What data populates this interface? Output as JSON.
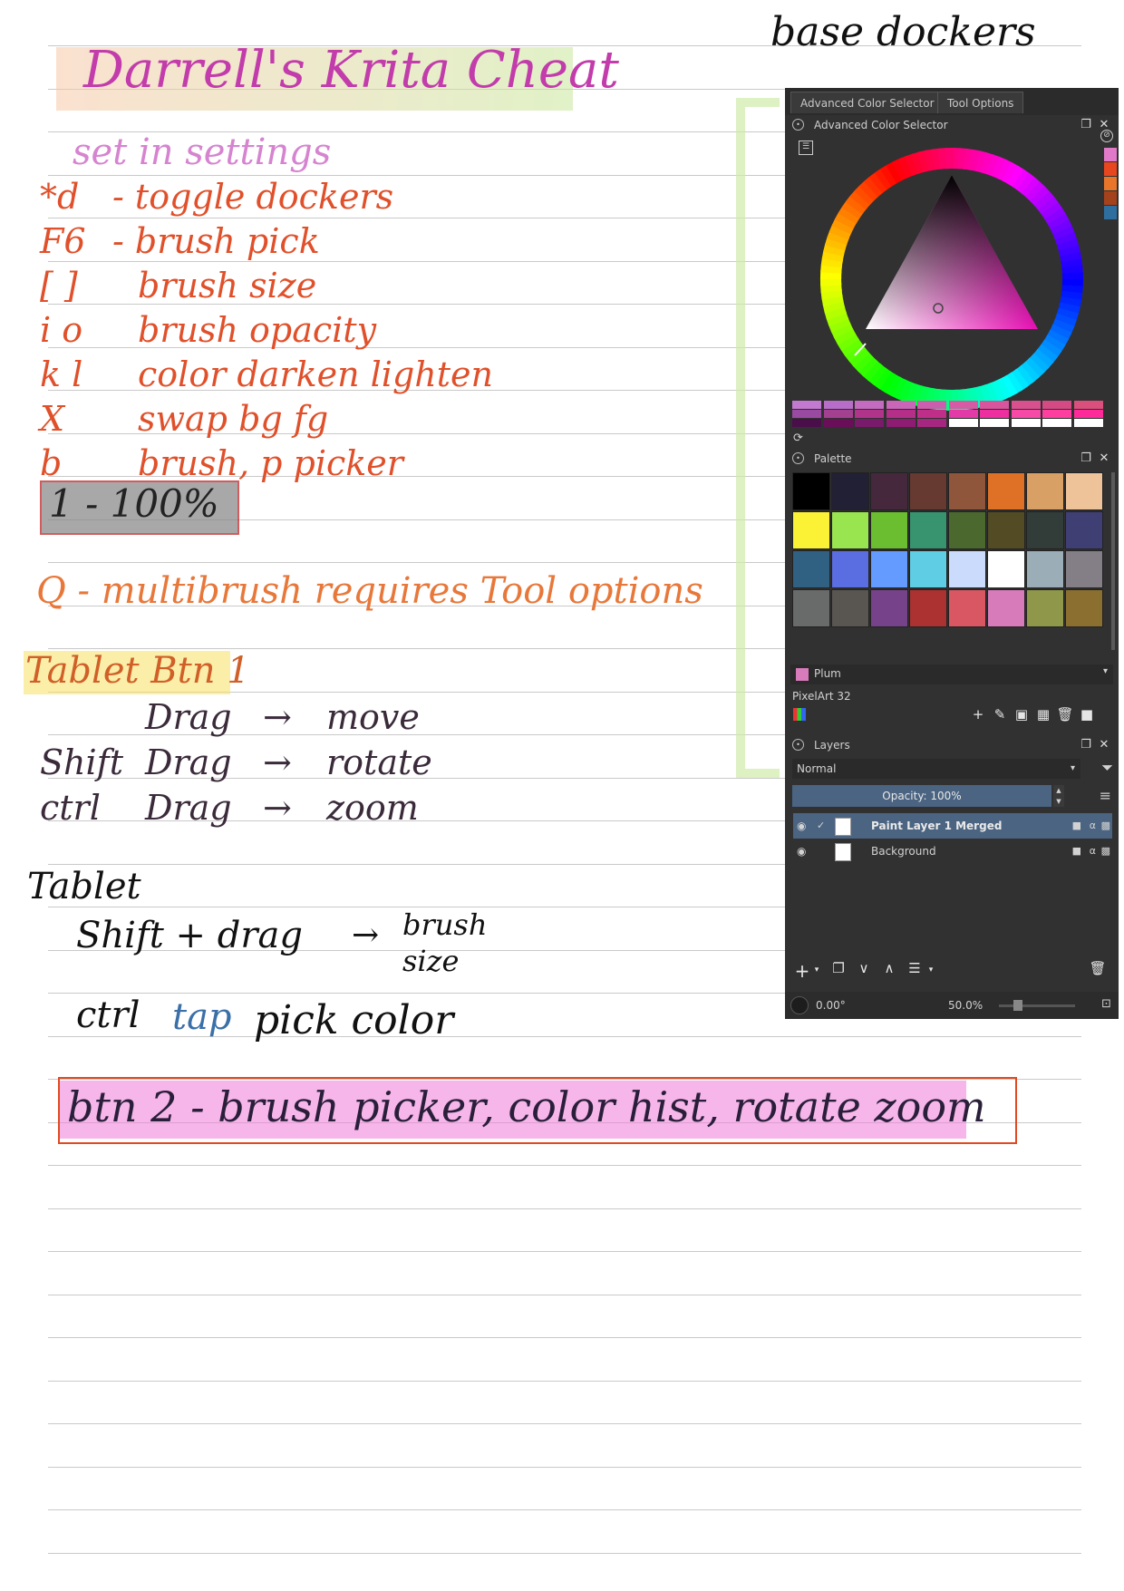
{
  "notes": {
    "title": "Darrell's Krita Cheat",
    "header_right": "base dockers",
    "settings_heading": "set in settings",
    "shortcuts": [
      {
        "key": "*d",
        "desc": "- toggle dockers"
      },
      {
        "key": "F6",
        "desc": "- brush pick"
      },
      {
        "key": "[ ]",
        "desc": "brush size"
      },
      {
        "key": "i o",
        "desc": "brush opacity"
      },
      {
        "key": "k l",
        "desc": "color darken lighten"
      },
      {
        "key": "X",
        "desc": "swap bg fg"
      },
      {
        "key": "b",
        "desc": "brush, p picker"
      }
    ],
    "one_hundred": "1 - 100%",
    "multibrush": "Q - multibrush requires Tool options",
    "tablet_btn1": {
      "heading": "Tablet Btn 1",
      "rows": [
        {
          "mod": "",
          "action": "Drag",
          "arrow": "→",
          "result": "move"
        },
        {
          "mod": "Shift",
          "action": "Drag",
          "arrow": "→",
          "result": "rotate"
        },
        {
          "mod": "ctrl",
          "action": "Drag",
          "arrow": "→",
          "result": "zoom"
        }
      ]
    },
    "tablet": {
      "heading": "Tablet",
      "shift_drag": "Shift + drag",
      "arrow": "→",
      "brush_size": "brush",
      "brush_size2": "size",
      "ctrl": "ctrl",
      "tap": "tap",
      "pick_color": "pick color"
    },
    "btn2": "btn 2 - brush picker, color hist, rotate zoom"
  },
  "krita": {
    "tabs": [
      "Advanced Color Selector",
      "Tool Options"
    ],
    "color_selector_title": "Advanced Color Selector",
    "palette_title": "Palette",
    "palette_selected": "Plum",
    "palette_name": "PixelArt 32",
    "layers_title": "Layers",
    "blend_mode": "Normal",
    "opacity": "Opacity:  100%",
    "layers": [
      {
        "name": "Paint Layer 1 Merged",
        "selected": true
      },
      {
        "name": "Background",
        "selected": false
      }
    ],
    "rotation": "0.00°",
    "zoom": "50.0%",
    "history_colors": [
      "#e07ac8",
      "#e8461e",
      "#e8752a",
      "#a4421c",
      "#2f6fa0"
    ],
    "palette_colors": [
      "#000000",
      "#222034",
      "#45283c",
      "#663931",
      "#8f563b",
      "#df7126",
      "#d9a066",
      "#eec39a",
      "#fbf236",
      "#99e550",
      "#6abe30",
      "#37946e",
      "#4b692f",
      "#524b24",
      "#323c39",
      "#3f3f74",
      "#306082",
      "#5b6ee1",
      "#639bff",
      "#5fcde4",
      "#cbdbfc",
      "#ffffff",
      "#9badb7",
      "#847e87",
      "#696a6a",
      "#595652",
      "#76428a",
      "#ac3232",
      "#d95763",
      "#d77bba",
      "#8f974a",
      "#8a6f30"
    ],
    "recent_swatches": [
      "#c27ad0",
      "#b86ec8",
      "#c46bbf",
      "#c966b8",
      "#cc5eae",
      "#d65aa4",
      "#d8549c",
      "#d9508e",
      "#d44a83",
      "#da4f7c",
      "#9a4aa0",
      "#a3408f",
      "#b0358a",
      "#b52f88",
      "#bf2f8a",
      "#e23aa6",
      "#ee2fa0",
      "#f74aa7",
      "#ff3fa0",
      "#ff2a9a",
      "#4a0e4a",
      "#6a0e5a",
      "#7a1a6a",
      "#8d1c72",
      "#a62780",
      "#ffffff",
      "#ffffff",
      "#ffffff",
      "#ffffff",
      "#ffffff"
    ]
  }
}
